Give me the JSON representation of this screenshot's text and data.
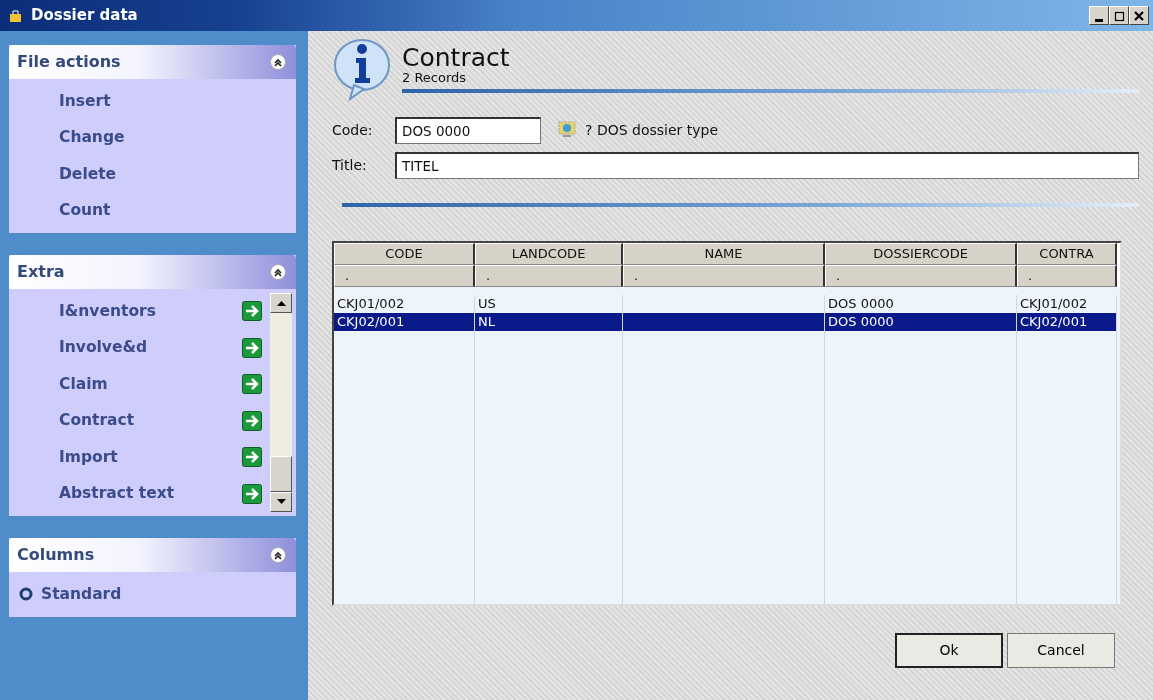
{
  "window": {
    "title": "Dossier data"
  },
  "sidebar": {
    "panels": [
      {
        "title": "File actions",
        "expanded": true,
        "items": [
          {
            "label": "Insert",
            "kind": "action"
          },
          {
            "label": "Change",
            "kind": "action"
          },
          {
            "label": "Delete",
            "kind": "action"
          },
          {
            "label": "Count",
            "kind": "action"
          }
        ]
      },
      {
        "title": "Extra",
        "expanded": true,
        "scrollable": true,
        "items": [
          {
            "label": "I&nventors",
            "kind": "link"
          },
          {
            "label": "Involve&d",
            "kind": "link"
          },
          {
            "label": "Claim",
            "kind": "link"
          },
          {
            "label": "Contract",
            "kind": "link"
          },
          {
            "label": "Import",
            "kind": "link"
          },
          {
            "label": "Abstract text",
            "kind": "link"
          }
        ]
      },
      {
        "title": "Columns",
        "expanded": true,
        "items": [
          {
            "label": "Standard",
            "kind": "radio",
            "selected": true
          }
        ]
      }
    ]
  },
  "header": {
    "title": "Contract",
    "subtitle": "2 Records"
  },
  "form": {
    "code": {
      "label": "Code:",
      "value": "DOS 0000",
      "lookup": "? DOS dossier type"
    },
    "title": {
      "label": "Title:",
      "value": "TITEL"
    }
  },
  "table": {
    "columns": [
      {
        "label": "CODE",
        "filter": "."
      },
      {
        "label": "LANDCODE",
        "filter": "."
      },
      {
        "label": "NAME",
        "filter": "."
      },
      {
        "label": "DOSSIERCODE",
        "filter": "."
      },
      {
        "label": "CONTRA",
        "filter": "."
      }
    ],
    "rows": [
      {
        "selected": false,
        "cells": [
          "CKJ01/002",
          "US",
          null,
          "DOS 0000",
          "CKJ01/002"
        ]
      },
      {
        "selected": true,
        "cells": [
          "CKJ02/001",
          "NL",
          null,
          "DOS 0000",
          "CKJ02/001"
        ]
      }
    ]
  },
  "buttons": [
    {
      "label": "Ok",
      "default": true
    },
    {
      "label": "Cancel",
      "default": false
    }
  ]
}
